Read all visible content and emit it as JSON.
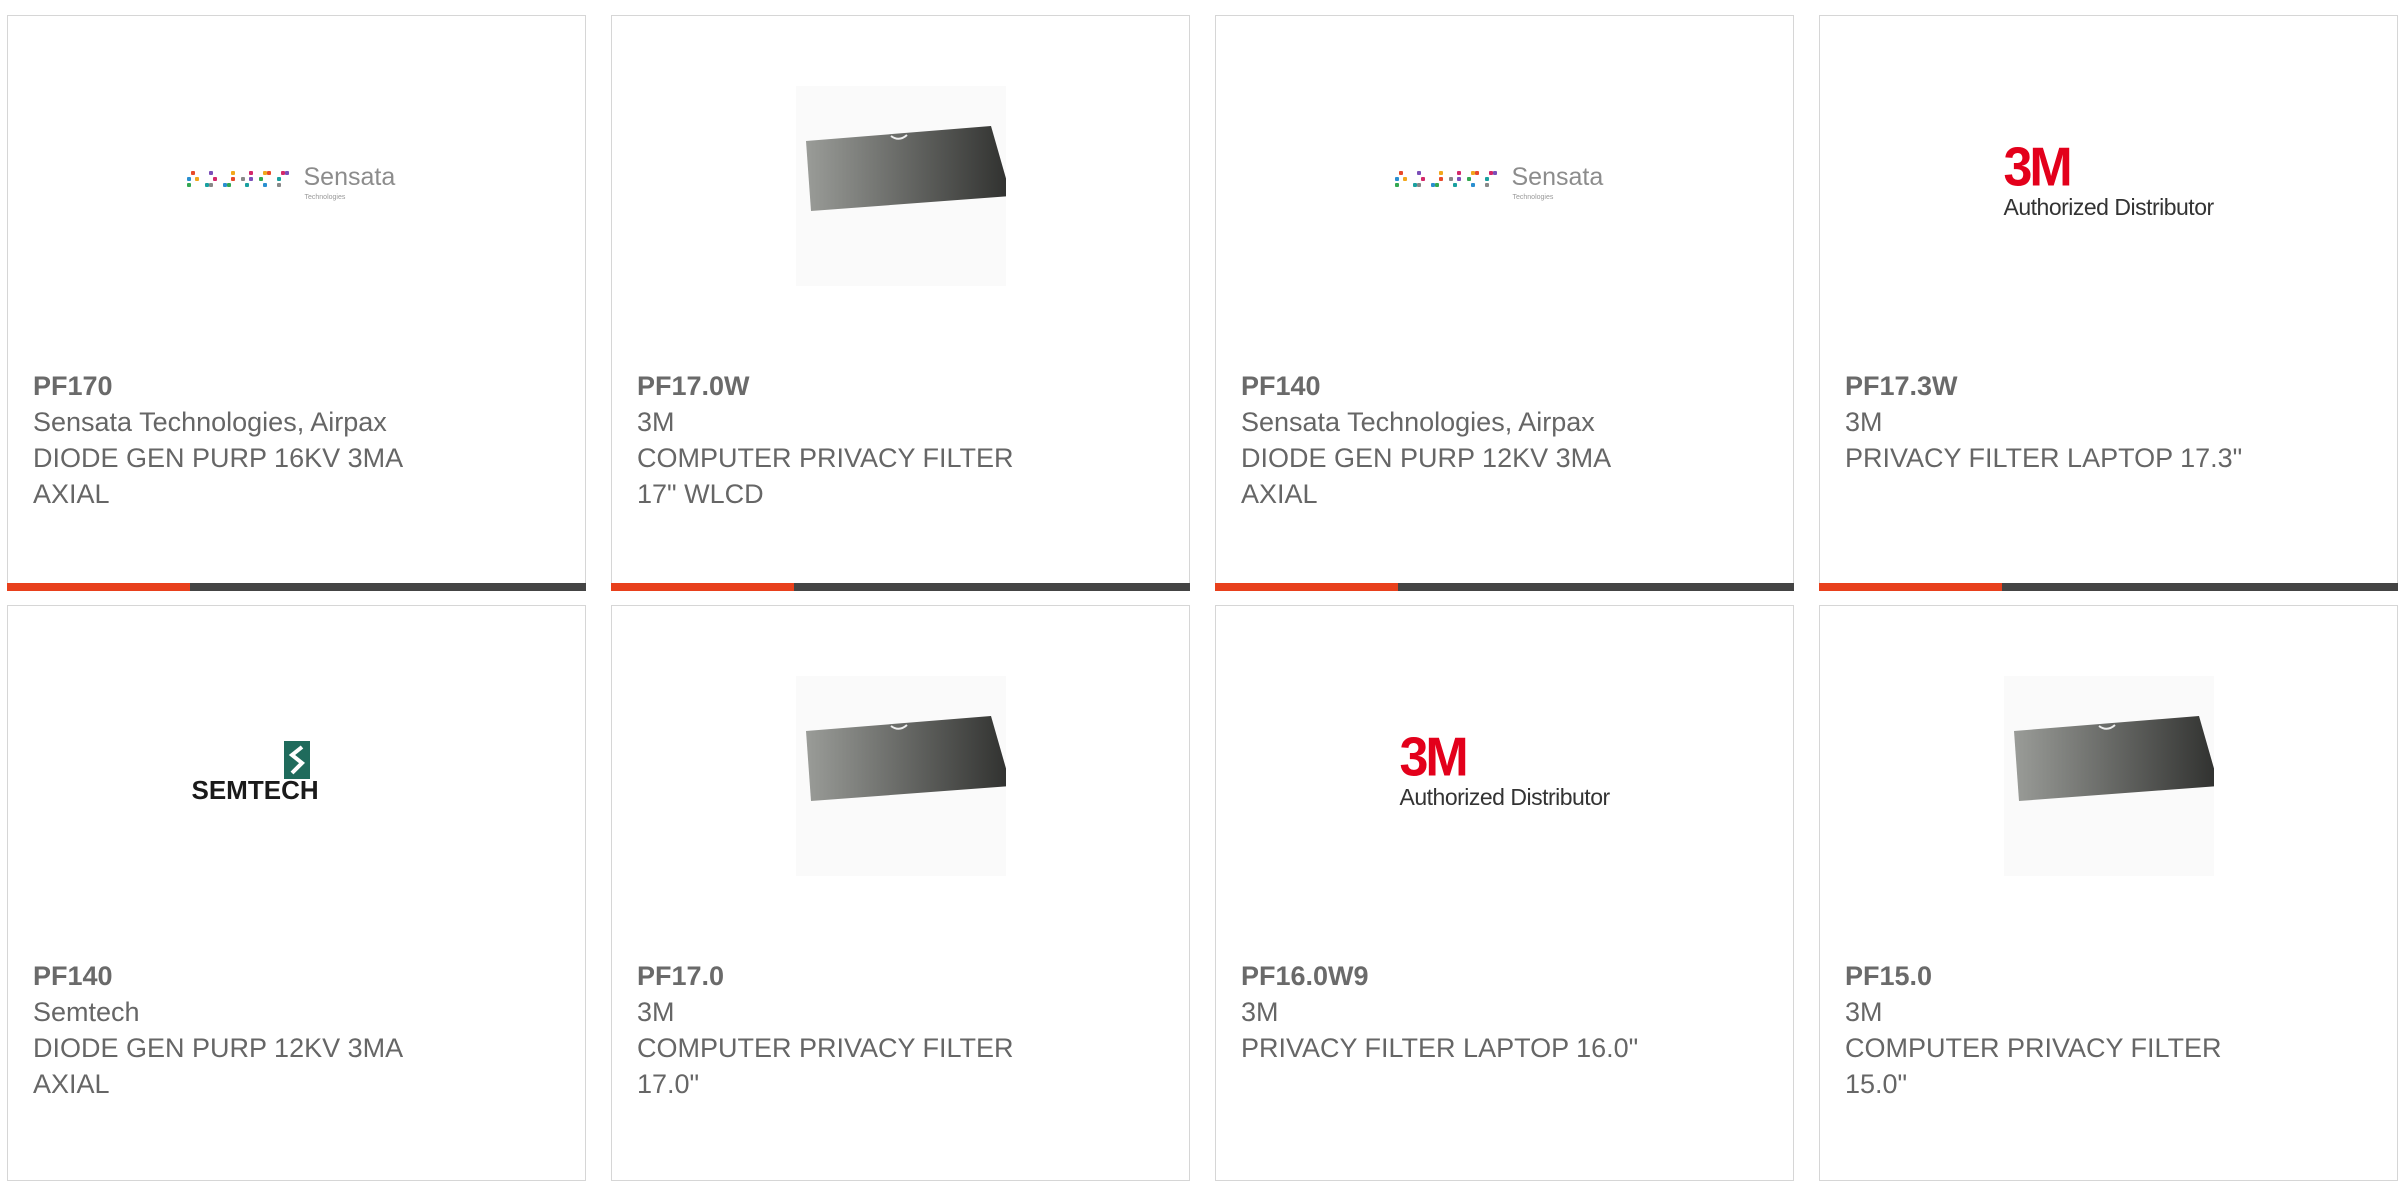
{
  "colors": {
    "accent": "#e8401c",
    "bar": "#444444",
    "text": "#666666",
    "border": "#d6d6d6"
  },
  "products": [
    {
      "part": "PF170",
      "manufacturer": "Sensata Technologies, Airpax",
      "description": "DIODE GEN PURP 16KV 3MA AXIAL",
      "image": "sensata-logo"
    },
    {
      "part": "PF17.0W",
      "manufacturer": "3M",
      "description": "COMPUTER PRIVACY FILTER 17\" WLCD",
      "image": "privacy-filter-image"
    },
    {
      "part": "PF140",
      "manufacturer": "Sensata Technologies, Airpax",
      "description": "DIODE GEN PURP 12KV 3MA AXIAL",
      "image": "sensata-logo"
    },
    {
      "part": "PF17.3W",
      "manufacturer": "3M",
      "description": "PRIVACY FILTER LAPTOP 17.3\"",
      "image": "3m-logo"
    },
    {
      "part": "PF140",
      "manufacturer": "Semtech",
      "description": "DIODE GEN PURP 12KV 3MA AXIAL",
      "image": "semtech-logo"
    },
    {
      "part": "PF17.0",
      "manufacturer": "3M",
      "description": "COMPUTER PRIVACY FILTER 17.0\"",
      "image": "privacy-filter-image"
    },
    {
      "part": "PF16.0W9",
      "manufacturer": "3M",
      "description": "PRIVACY FILTER LAPTOP 16.0\"",
      "image": "3m-logo"
    },
    {
      "part": "PF15.0",
      "manufacturer": "3M",
      "description": "COMPUTER PRIVACY FILTER 15.0\"",
      "image": "privacy-filter-image"
    }
  ],
  "logos": {
    "sensata": {
      "name": "Sensata",
      "sub": "Technologies"
    },
    "m3": {
      "mark": "3M",
      "tagline": "Authorized Distributor"
    },
    "semtech": {
      "name": "SEMTECH"
    }
  }
}
